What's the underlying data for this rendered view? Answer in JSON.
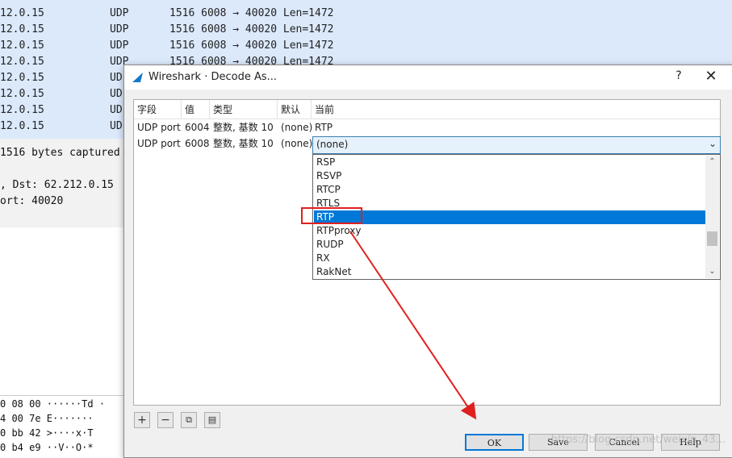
{
  "background": {
    "packet_rows": [
      {
        "addr": "12.0.15",
        "proto": "UDP",
        "info": "1516 6008 → 40020 Len=1472"
      },
      {
        "addr": "12.0.15",
        "proto": "UDP",
        "info": "1516 6008 → 40020 Len=1472"
      },
      {
        "addr": "12.0.15",
        "proto": "UDP",
        "info": "1516 6008 → 40020 Len=1472"
      },
      {
        "addr": "12.0.15",
        "proto": "UDP",
        "info": "1516 6008 → 40020 Len=1472"
      },
      {
        "addr": "12.0.15",
        "proto": "UD",
        "info": ""
      },
      {
        "addr": "12.0.15",
        "proto": "UD",
        "info": ""
      },
      {
        "addr": "12.0.15",
        "proto": "UD",
        "info": ""
      },
      {
        "addr": "12.0.15",
        "proto": "UD",
        "info": ""
      }
    ],
    "detail_lines": [
      "1516 bytes captured",
      "",
      ", Dst: 62.212.0.15",
      "ort: 40020"
    ],
    "hex_lines": [
      "0 08 00   ······Td ·",
      "4 00 7e   E·······",
      "0 bb 42   >····x·T",
      "0 b4 e9   ··V··O·*"
    ]
  },
  "dialog": {
    "title": "Wireshark · Decode As...",
    "help_glyph": "?",
    "close_glyph": "✕",
    "columns": [
      "字段",
      "值",
      "类型",
      "默认",
      "当前"
    ],
    "rows": [
      {
        "field": "UDP port",
        "value": "6004",
        "type": "整数, 基数 10",
        "default": "(none)",
        "current": "RTP"
      },
      {
        "field": "UDP port",
        "value": "6008",
        "type": "整数, 基数 10",
        "default": "(none)",
        "current": "(none)"
      }
    ],
    "dropdown_options": [
      "RSP",
      "RSVP",
      "RTCP",
      "RTLS",
      "RTP",
      "RTPproxy",
      "RUDP",
      "RX",
      "RakNet"
    ],
    "selected_option": "RTP",
    "toolbar": {
      "add": "+",
      "remove": "−",
      "copy": "⧉",
      "clear": "▤"
    },
    "buttons": {
      "ok": "OK",
      "save": "Save",
      "cancel": "Cancel",
      "help": "Help"
    }
  },
  "watermark": "https://blog.csdn.net/weixin_43..."
}
